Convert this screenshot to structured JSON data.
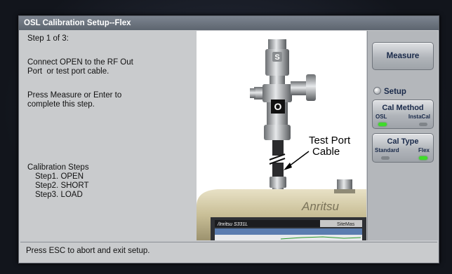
{
  "window": {
    "title": "OSL Calibration Setup--Flex"
  },
  "instructions": {
    "step": "Step 1 of 3:",
    "connect_line1": "Connect OPEN to the RF Out",
    "connect_line2": "Port  or test port cable.",
    "press_line1": "Press Measure or Enter to",
    "press_line2": "complete this step.",
    "steps_heading": "Calibration Steps",
    "steps": [
      "Step1. OPEN",
      "Step2. SHORT",
      "Step3. LOAD"
    ]
  },
  "illustration": {
    "connector_label": "O",
    "connector_s": "S",
    "callout_line1": "Test Port",
    "callout_line2": "Cable",
    "brand": "Anritsu",
    "model": "/Inritsu S331L",
    "screen_tab": "SiteMas"
  },
  "softkeys": {
    "measure": "Measure",
    "setup": "Setup",
    "cal_method": {
      "label": "Cal Method",
      "options": [
        "OSL",
        "InstaCal"
      ],
      "selected": "OSL"
    },
    "cal_type": {
      "label": "Cal Type",
      "options": [
        "Standard",
        "Flex"
      ],
      "selected": "Flex"
    }
  },
  "status": {
    "text": "Press ESC to abort and exit setup."
  },
  "colors": {
    "indicator_on": "#3fdc2a",
    "title_bar": "#6b7380",
    "panel": "#c9cbcd"
  }
}
